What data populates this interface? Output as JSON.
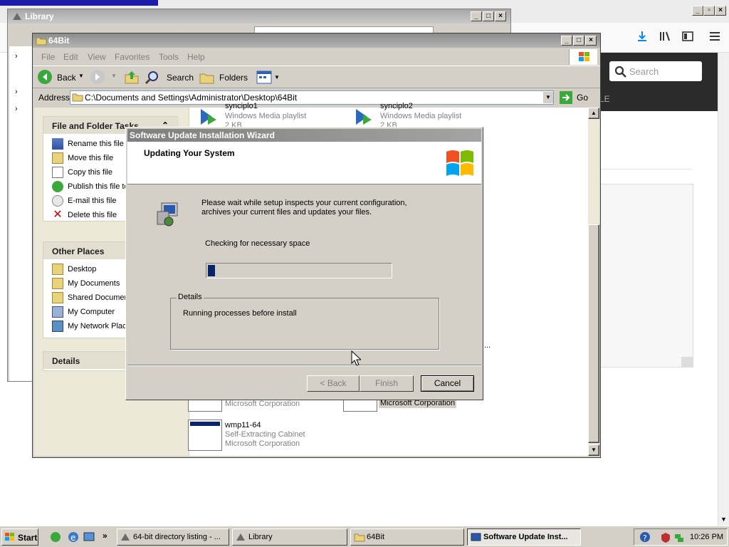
{
  "firefox": {
    "search_placeholder": "Search",
    "partial_label": "LE"
  },
  "library": {
    "title": "Library"
  },
  "explorer": {
    "title": "64Bit",
    "menu": [
      "File",
      "Edit",
      "View",
      "Favorites",
      "Tools",
      "Help"
    ],
    "toolbar": {
      "back": "Back",
      "search": "Search",
      "folders": "Folders"
    },
    "address_label": "Address",
    "address_value": "C:\\Documents and Settings\\Administrator\\Desktop\\64Bit",
    "go_label": "Go",
    "file_folder_tasks": {
      "title": "File and Folder Tasks",
      "items": [
        "Rename this file",
        "Move this file",
        "Copy this file",
        "Publish this file to",
        "E-mail this file",
        "Delete this file"
      ]
    },
    "other_places": {
      "title": "Other Places",
      "items": [
        "Desktop",
        "My Documents",
        "Shared Documen",
        "My Computer",
        "My Network Plac"
      ]
    },
    "details_title": "Details",
    "files": [
      {
        "name": "synciplo1",
        "type": "Windows Media playlist",
        "size": "2 KB"
      },
      {
        "name": "synciplo2",
        "type": "Windows Media playlist",
        "size": "2 KB"
      },
      {
        "company": "Microsoft Corporation"
      },
      {
        "company": "Microsoft Corporation"
      },
      {
        "name": "wmp11-64",
        "type": "Self-Extracting Cabinet",
        "company": "Microsoft Corporation"
      }
    ],
    "ellipsis": "..."
  },
  "dialog": {
    "title": "Software Update Installation Wizard",
    "heading": "Updating Your System",
    "description": "Please wait while setup inspects your current configuration, archives your current files and updates your files.",
    "status": "Checking for necessary space",
    "progress": 0.04,
    "details_label": "Details",
    "details_text": "Running processes before install",
    "buttons": {
      "back": "< Back",
      "finish": "Finish",
      "cancel": "Cancel"
    }
  },
  "taskbar": {
    "start": "Start",
    "more": "»",
    "tasks": [
      "64-bit directory listing - ...",
      "Library",
      "64Bit",
      "Software Update Inst..."
    ],
    "clock": "10:26 PM"
  }
}
